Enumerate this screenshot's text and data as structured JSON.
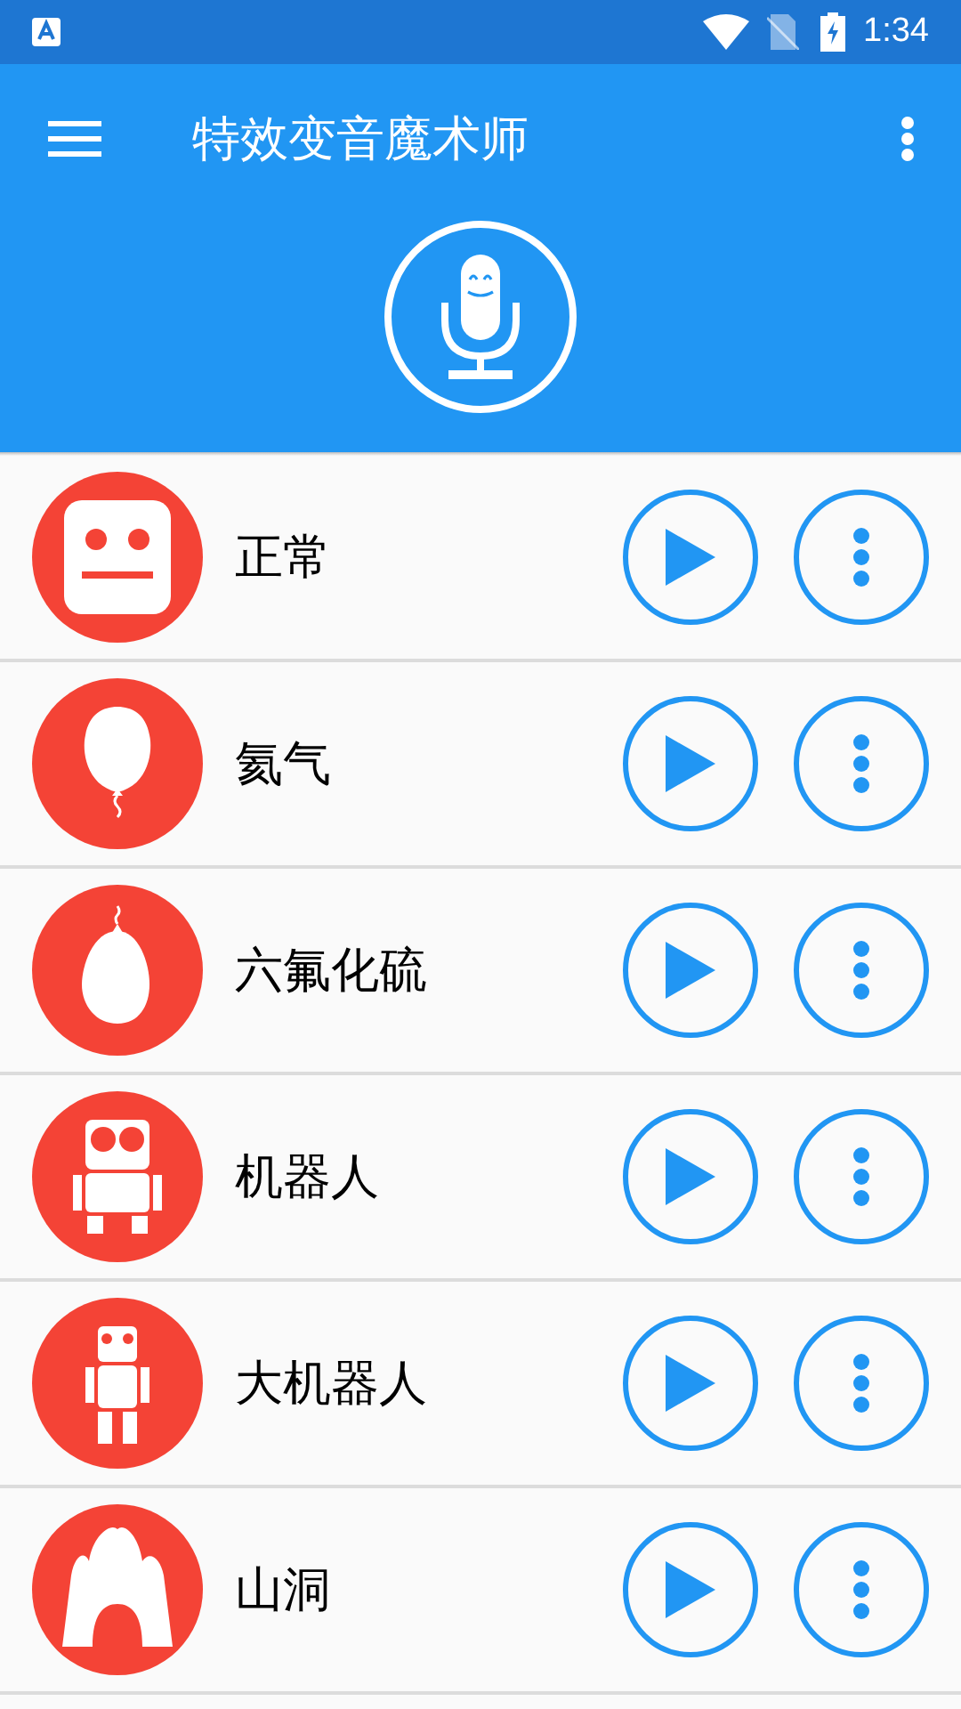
{
  "status_bar": {
    "time": "1:34"
  },
  "app_bar": {
    "title": "特效变音魔术师"
  },
  "effects": [
    {
      "label": "正常",
      "kind": "face"
    },
    {
      "label": "氦气",
      "kind": "balloon"
    },
    {
      "label": "六氟化硫",
      "kind": "heavy-balloon"
    },
    {
      "label": "机器人",
      "kind": "robot"
    },
    {
      "label": "大机器人",
      "kind": "tall-robot"
    },
    {
      "label": "山洞",
      "kind": "cave"
    }
  ]
}
